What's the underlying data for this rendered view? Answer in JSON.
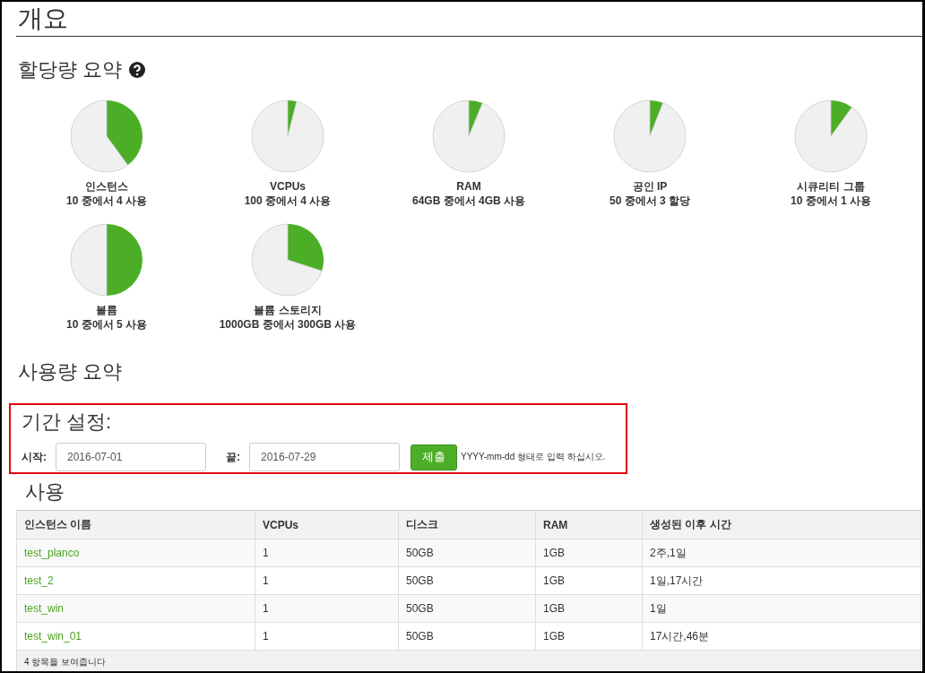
{
  "page_title": "개요",
  "quota_section": {
    "title": "할당량 요약"
  },
  "quotas": [
    {
      "name": "인스턴스",
      "usage": "10 중에서 4 사용",
      "chart_data": {
        "type": "pie",
        "values": [
          40,
          60
        ]
      }
    },
    {
      "name": "VCPUs",
      "usage": "100 중에서 4 사용",
      "chart_data": {
        "type": "pie",
        "values": [
          4,
          96
        ]
      }
    },
    {
      "name": "RAM",
      "usage": "64GB 중에서 4GB 사용",
      "chart_data": {
        "type": "pie",
        "values": [
          6.25,
          93.75
        ]
      }
    },
    {
      "name": "공인 IP",
      "usage": "50 중에서 3 할당",
      "chart_data": {
        "type": "pie",
        "values": [
          6,
          94
        ]
      }
    },
    {
      "name": "시큐리티 그룹",
      "usage": "10 중에서 1 사용",
      "chart_data": {
        "type": "pie",
        "values": [
          10,
          90
        ]
      }
    },
    {
      "name": "볼륨",
      "usage": "10 중에서 5 사용",
      "chart_data": {
        "type": "pie",
        "values": [
          50,
          50
        ]
      }
    },
    {
      "name": "볼륨 스토리지",
      "usage": "1000GB 중에서 300GB 사용",
      "chart_data": {
        "type": "pie",
        "values": [
          30,
          70
        ]
      }
    }
  ],
  "usage_section": {
    "title": "사용량 요약"
  },
  "period": {
    "title": "기간 설정:",
    "start_label": "시작:",
    "start_value": "2016-07-01",
    "end_label": "끝:",
    "end_value": "2016-07-29",
    "submit": "제출",
    "hint": "YYYY-mm-dd 형태로 입력 하십시오."
  },
  "usage_table": {
    "title": "사용",
    "columns": [
      "인스턴스 이름",
      "VCPUs",
      "디스크",
      "RAM",
      "생성된 이후 시간"
    ],
    "rows": [
      [
        "test_planco",
        "1",
        "50GB",
        "1GB",
        "2주,1일"
      ],
      [
        "test_2",
        "1",
        "50GB",
        "1GB",
        "1일,17시간"
      ],
      [
        "test_win",
        "1",
        "50GB",
        "1GB",
        "1일"
      ],
      [
        "test_win_01",
        "1",
        "50GB",
        "1GB",
        "17시간,46분"
      ]
    ],
    "footer": "4 항목을 보여줍니다"
  }
}
